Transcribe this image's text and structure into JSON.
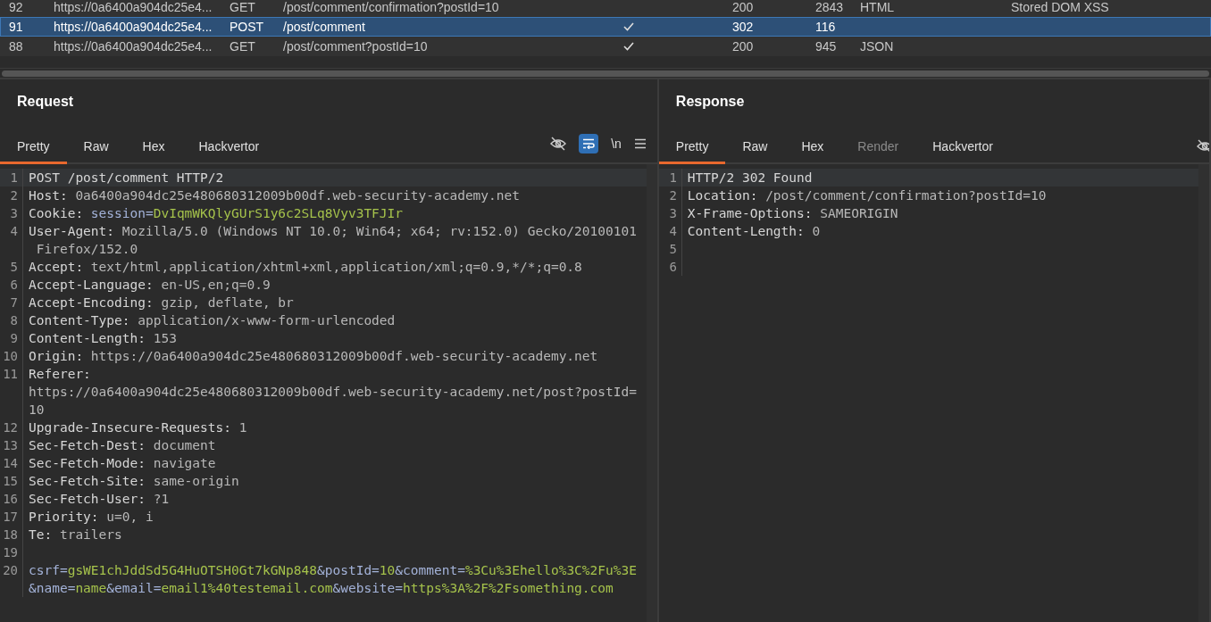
{
  "history": {
    "rows": [
      {
        "number": "92",
        "host": "https://0a6400a904dc25e4...",
        "method": "GET",
        "url": "/post/comment/confirmation?postId=10",
        "edited": false,
        "status": "200",
        "length": "2843",
        "mime": "HTML",
        "notes": "Stored DOM XSS",
        "selected": false
      },
      {
        "number": "91",
        "host": "https://0a6400a904dc25e4...",
        "method": "POST",
        "url": "/post/comment",
        "edited": true,
        "status": "302",
        "length": "116",
        "selected": true
      },
      {
        "number": "88",
        "host": "https://0a6400a904dc25e4...",
        "method": "GET",
        "url": "/post/comment?postId=10",
        "edited": true,
        "status": "200",
        "length": "945",
        "mime": "JSON",
        "selected": false
      }
    ]
  },
  "request": {
    "title": "Request",
    "tabs": [
      {
        "label": "Pretty",
        "selected": true,
        "disabled": false
      },
      {
        "label": "Raw",
        "selected": false,
        "disabled": false
      },
      {
        "label": "Hex",
        "selected": false,
        "disabled": false
      },
      {
        "label": "Hackvertor",
        "selected": false,
        "disabled": false
      }
    ],
    "toolbar": {
      "wrap_on": true,
      "newline_label": "\\n"
    },
    "lines": [
      {
        "number": "1",
        "current": true,
        "wraps": [
          {
            "segments": [
              {
                "text": "POST /post/comment HTTP/2",
                "kind": "name"
              }
            ]
          }
        ]
      },
      {
        "number": "2",
        "current": false,
        "wraps": [
          {
            "segments": [
              {
                "text": "Host: ",
                "kind": "name"
              },
              {
                "text": "0a6400a904dc25e480680312009b00df.web-security-academy.net",
                "kind": "value"
              }
            ]
          }
        ]
      },
      {
        "number": "3",
        "current": false,
        "wraps": [
          {
            "segments": [
              {
                "text": "Cookie: ",
                "kind": "name"
              },
              {
                "text": "session",
                "kind": "param"
              },
              {
                "text": "=",
                "kind": "param"
              },
              {
                "text": "DvIqmWKQlyGUrS1y6c2SLq8Vyv3TFJIr",
                "kind": "green"
              }
            ]
          }
        ]
      },
      {
        "number": "4",
        "current": false,
        "wraps": [
          {
            "segments": [
              {
                "text": "User-Agent: ",
                "kind": "name"
              },
              {
                "text": "Mozilla/5.0 (Windows NT 10.0; Win64; x64; rv:152.0) Gecko/20100101",
                "kind": "value"
              }
            ]
          },
          {
            "segments": [
              {
                "text": " Firefox/152.0",
                "kind": "value"
              }
            ]
          }
        ]
      },
      {
        "number": "5",
        "current": false,
        "wraps": [
          {
            "segments": [
              {
                "text": "Accept: ",
                "kind": "name"
              },
              {
                "text": "text/html,application/xhtml+xml,application/xml;q=0.9,*/*;q=0.8",
                "kind": "value"
              }
            ]
          }
        ]
      },
      {
        "number": "6",
        "current": false,
        "wraps": [
          {
            "segments": [
              {
                "text": "Accept-Language: ",
                "kind": "name"
              },
              {
                "text": "en-US,en;q=0.9",
                "kind": "value"
              }
            ]
          }
        ]
      },
      {
        "number": "7",
        "current": false,
        "wraps": [
          {
            "segments": [
              {
                "text": "Accept-Encoding: ",
                "kind": "name"
              },
              {
                "text": "gzip, deflate, br",
                "kind": "value"
              }
            ]
          }
        ]
      },
      {
        "number": "8",
        "current": false,
        "wraps": [
          {
            "segments": [
              {
                "text": "Content-Type: ",
                "kind": "name"
              },
              {
                "text": "application/x-www-form-urlencoded",
                "kind": "value"
              }
            ]
          }
        ]
      },
      {
        "number": "9",
        "current": false,
        "wraps": [
          {
            "segments": [
              {
                "text": "Content-Length: ",
                "kind": "name"
              },
              {
                "text": "153",
                "kind": "value"
              }
            ]
          }
        ]
      },
      {
        "number": "10",
        "current": false,
        "wraps": [
          {
            "segments": [
              {
                "text": "Origin: ",
                "kind": "name"
              },
              {
                "text": "https://0a6400a904dc25e480680312009b00df.web-security-academy.net",
                "kind": "value"
              }
            ]
          }
        ]
      },
      {
        "number": "11",
        "current": false,
        "wraps": [
          {
            "segments": [
              {
                "text": "Referer:",
                "kind": "name"
              }
            ]
          },
          {
            "segments": [
              {
                "text": "https://0a6400a904dc25e480680312009b00df.web-security-academy.net/post?postId=",
                "kind": "value"
              }
            ]
          },
          {
            "segments": [
              {
                "text": "10",
                "kind": "value"
              }
            ]
          }
        ]
      },
      {
        "number": "12",
        "current": false,
        "wraps": [
          {
            "segments": [
              {
                "text": "Upgrade-Insecure-Requests: ",
                "kind": "name"
              },
              {
                "text": "1",
                "kind": "value"
              }
            ]
          }
        ]
      },
      {
        "number": "13",
        "current": false,
        "wraps": [
          {
            "segments": [
              {
                "text": "Sec-Fetch-Dest: ",
                "kind": "name"
              },
              {
                "text": "document",
                "kind": "value"
              }
            ]
          }
        ]
      },
      {
        "number": "14",
        "current": false,
        "wraps": [
          {
            "segments": [
              {
                "text": "Sec-Fetch-Mode: ",
                "kind": "name"
              },
              {
                "text": "navigate",
                "kind": "value"
              }
            ]
          }
        ]
      },
      {
        "number": "15",
        "current": false,
        "wraps": [
          {
            "segments": [
              {
                "text": "Sec-Fetch-Site: ",
                "kind": "name"
              },
              {
                "text": "same-origin",
                "kind": "value"
              }
            ]
          }
        ]
      },
      {
        "number": "16",
        "current": false,
        "wraps": [
          {
            "segments": [
              {
                "text": "Sec-Fetch-User: ",
                "kind": "name"
              },
              {
                "text": "?1",
                "kind": "value"
              }
            ]
          }
        ]
      },
      {
        "number": "17",
        "current": false,
        "wraps": [
          {
            "segments": [
              {
                "text": "Priority: ",
                "kind": "name"
              },
              {
                "text": "u=0, i",
                "kind": "value"
              }
            ]
          }
        ]
      },
      {
        "number": "18",
        "current": false,
        "wraps": [
          {
            "segments": [
              {
                "text": "Te: ",
                "kind": "name"
              },
              {
                "text": "trailers",
                "kind": "value"
              }
            ]
          }
        ]
      },
      {
        "number": "19",
        "current": false
      },
      {
        "number": "20",
        "current": false,
        "wraps": [
          {
            "segments": [
              {
                "text": "csrf=",
                "kind": "param"
              },
              {
                "text": "gsWE1chJddSd5G4HuOTSH0Gt7kGNp848",
                "kind": "green"
              },
              {
                "text": "&postId=",
                "kind": "param"
              },
              {
                "text": "10",
                "kind": "green"
              },
              {
                "text": "&comment=",
                "kind": "param"
              },
              {
                "text": "%3Cu%3Ehello%3C%2Fu%3E",
                "kind": "green"
              }
            ]
          },
          {
            "segments": [
              {
                "text": "&name=",
                "kind": "param"
              },
              {
                "text": "name",
                "kind": "green"
              },
              {
                "text": "&email=",
                "kind": "param"
              },
              {
                "text": "email1%40testemail.com",
                "kind": "green"
              },
              {
                "text": "&website=",
                "kind": "param"
              },
              {
                "text": "https%3A%2F%2Fsomething.com",
                "kind": "green"
              }
            ]
          }
        ]
      }
    ]
  },
  "response": {
    "title": "Response",
    "tabs": [
      {
        "label": "Pretty",
        "selected": true,
        "disabled": false
      },
      {
        "label": "Raw",
        "selected": false,
        "disabled": false
      },
      {
        "label": "Hex",
        "selected": false,
        "disabled": false
      },
      {
        "label": "Render",
        "selected": false,
        "disabled": true
      },
      {
        "label": "Hackvertor",
        "selected": false,
        "disabled": false
      }
    ],
    "lines": [
      {
        "number": "1",
        "current": true,
        "wraps": [
          {
            "segments": [
              {
                "text": "HTTP/2 302 Found",
                "kind": "name"
              }
            ]
          }
        ]
      },
      {
        "number": "2",
        "current": false,
        "wraps": [
          {
            "segments": [
              {
                "text": "Location: ",
                "kind": "name"
              },
              {
                "text": "/post/comment/confirmation?postId=10",
                "kind": "value"
              }
            ]
          }
        ]
      },
      {
        "number": "3",
        "current": false,
        "wraps": [
          {
            "segments": [
              {
                "text": "X-Frame-Options: ",
                "kind": "name"
              },
              {
                "text": "SAMEORIGIN",
                "kind": "value"
              }
            ]
          }
        ]
      },
      {
        "number": "4",
        "current": false,
        "wraps": [
          {
            "segments": [
              {
                "text": "Content-Length: ",
                "kind": "name"
              },
              {
                "text": "0",
                "kind": "value"
              }
            ]
          }
        ]
      },
      {
        "number": "5",
        "current": false
      },
      {
        "number": "6",
        "current": false
      }
    ]
  }
}
